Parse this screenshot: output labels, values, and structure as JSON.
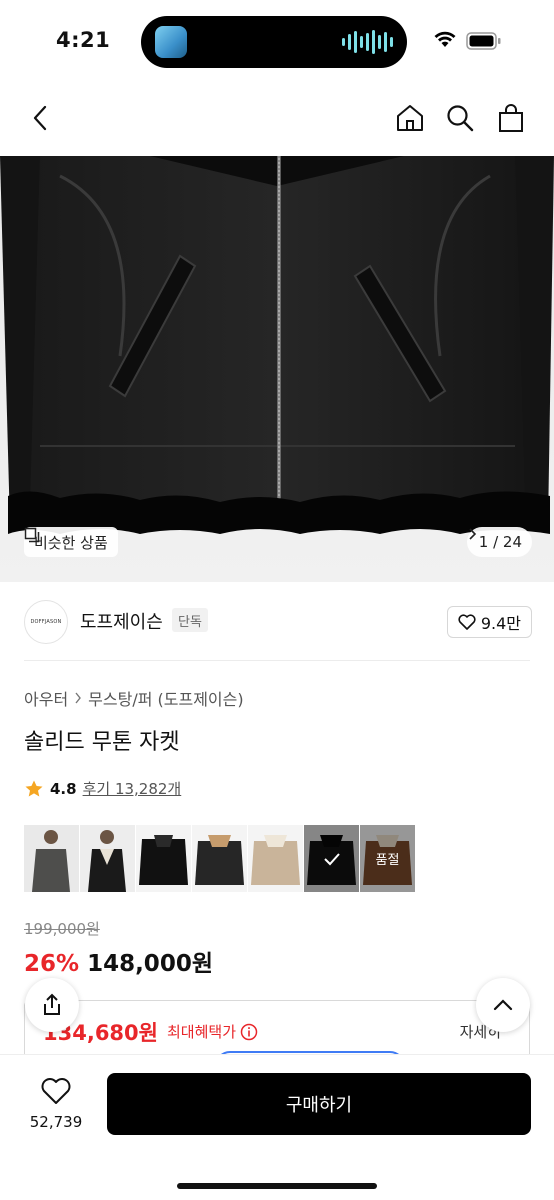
{
  "status_bar": {
    "time": "4:21"
  },
  "hero": {
    "similar_label": "비슷한 상품",
    "page_indicator": "1 / 24"
  },
  "brand": {
    "logo_text": "DOFFJASON",
    "name": "도프제이슨",
    "badge": "단독",
    "like_count": "9.4만"
  },
  "product": {
    "breadcrumb": [
      "아우터",
      "무스탕/퍼 (도프제이슨)"
    ],
    "title": "솔리드 무톤 자켓",
    "rating": "4.8",
    "review_link": "후기 13,282개",
    "thumbnails": [
      {
        "color": "#5a5a58"
      },
      {
        "color": "#1d1d1d"
      },
      {
        "color": "#111111"
      },
      {
        "color": "#2a2a2a"
      },
      {
        "color": "#c9b49a"
      },
      {
        "color": "#151515",
        "selected": true
      },
      {
        "color": "#7a4a2b",
        "soldout": "품절"
      }
    ],
    "original_price": "199,000원",
    "discount": "26%",
    "price": "148,000원",
    "benefit_price": "134,680원",
    "benefit_label": "최대혜택가",
    "benefit_detail": "자세히"
  },
  "bottom": {
    "wish_count": "52,739",
    "buy_label": "구매하기"
  },
  "colors": {
    "accent_red": "#e8262a",
    "buy_button": "#000000"
  }
}
